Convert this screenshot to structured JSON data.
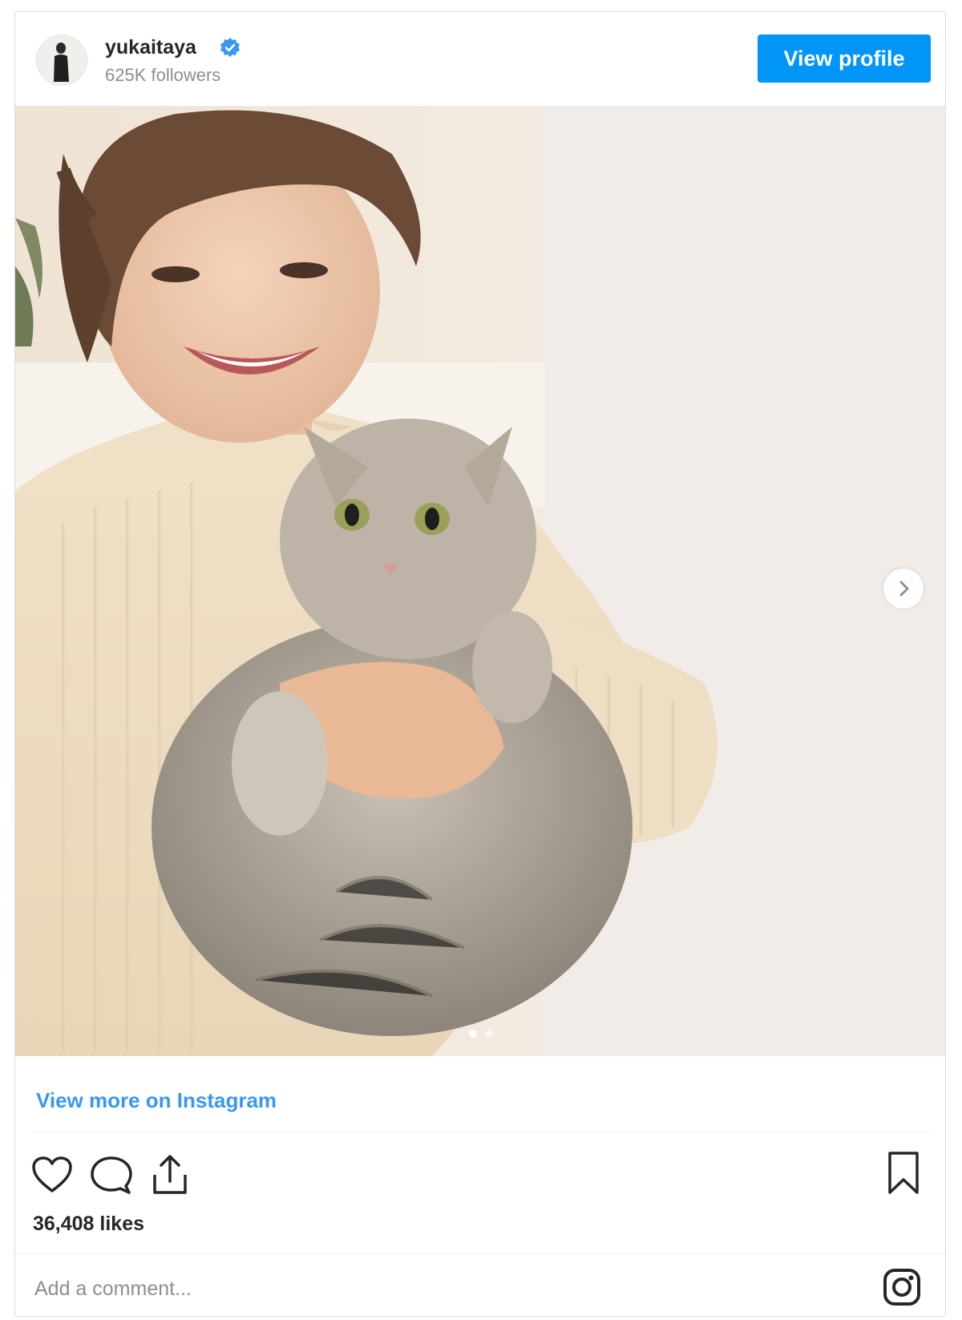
{
  "header": {
    "username": "yukaitaya",
    "verified": true,
    "followers": "625K followers",
    "view_profile_label": "View profile",
    "avatar_icon": "user-avatar"
  },
  "photo": {
    "carousel_total": 2,
    "carousel_current": 1,
    "next_icon": "chevron-right-icon"
  },
  "links": {
    "view_more": "View more on Instagram"
  },
  "actions": {
    "like_icon": "heart-icon",
    "comment_icon": "comment-icon",
    "share_icon": "share-icon",
    "save_icon": "bookmark-icon"
  },
  "likes": "36,408 likes",
  "comment": {
    "placeholder": "Add a comment...",
    "logo_icon": "instagram-icon"
  },
  "colors": {
    "accent": "#0095f6",
    "link": "#3897f0",
    "text": "#262626",
    "muted": "#8e8e8e",
    "border": "#dbdbdb"
  }
}
